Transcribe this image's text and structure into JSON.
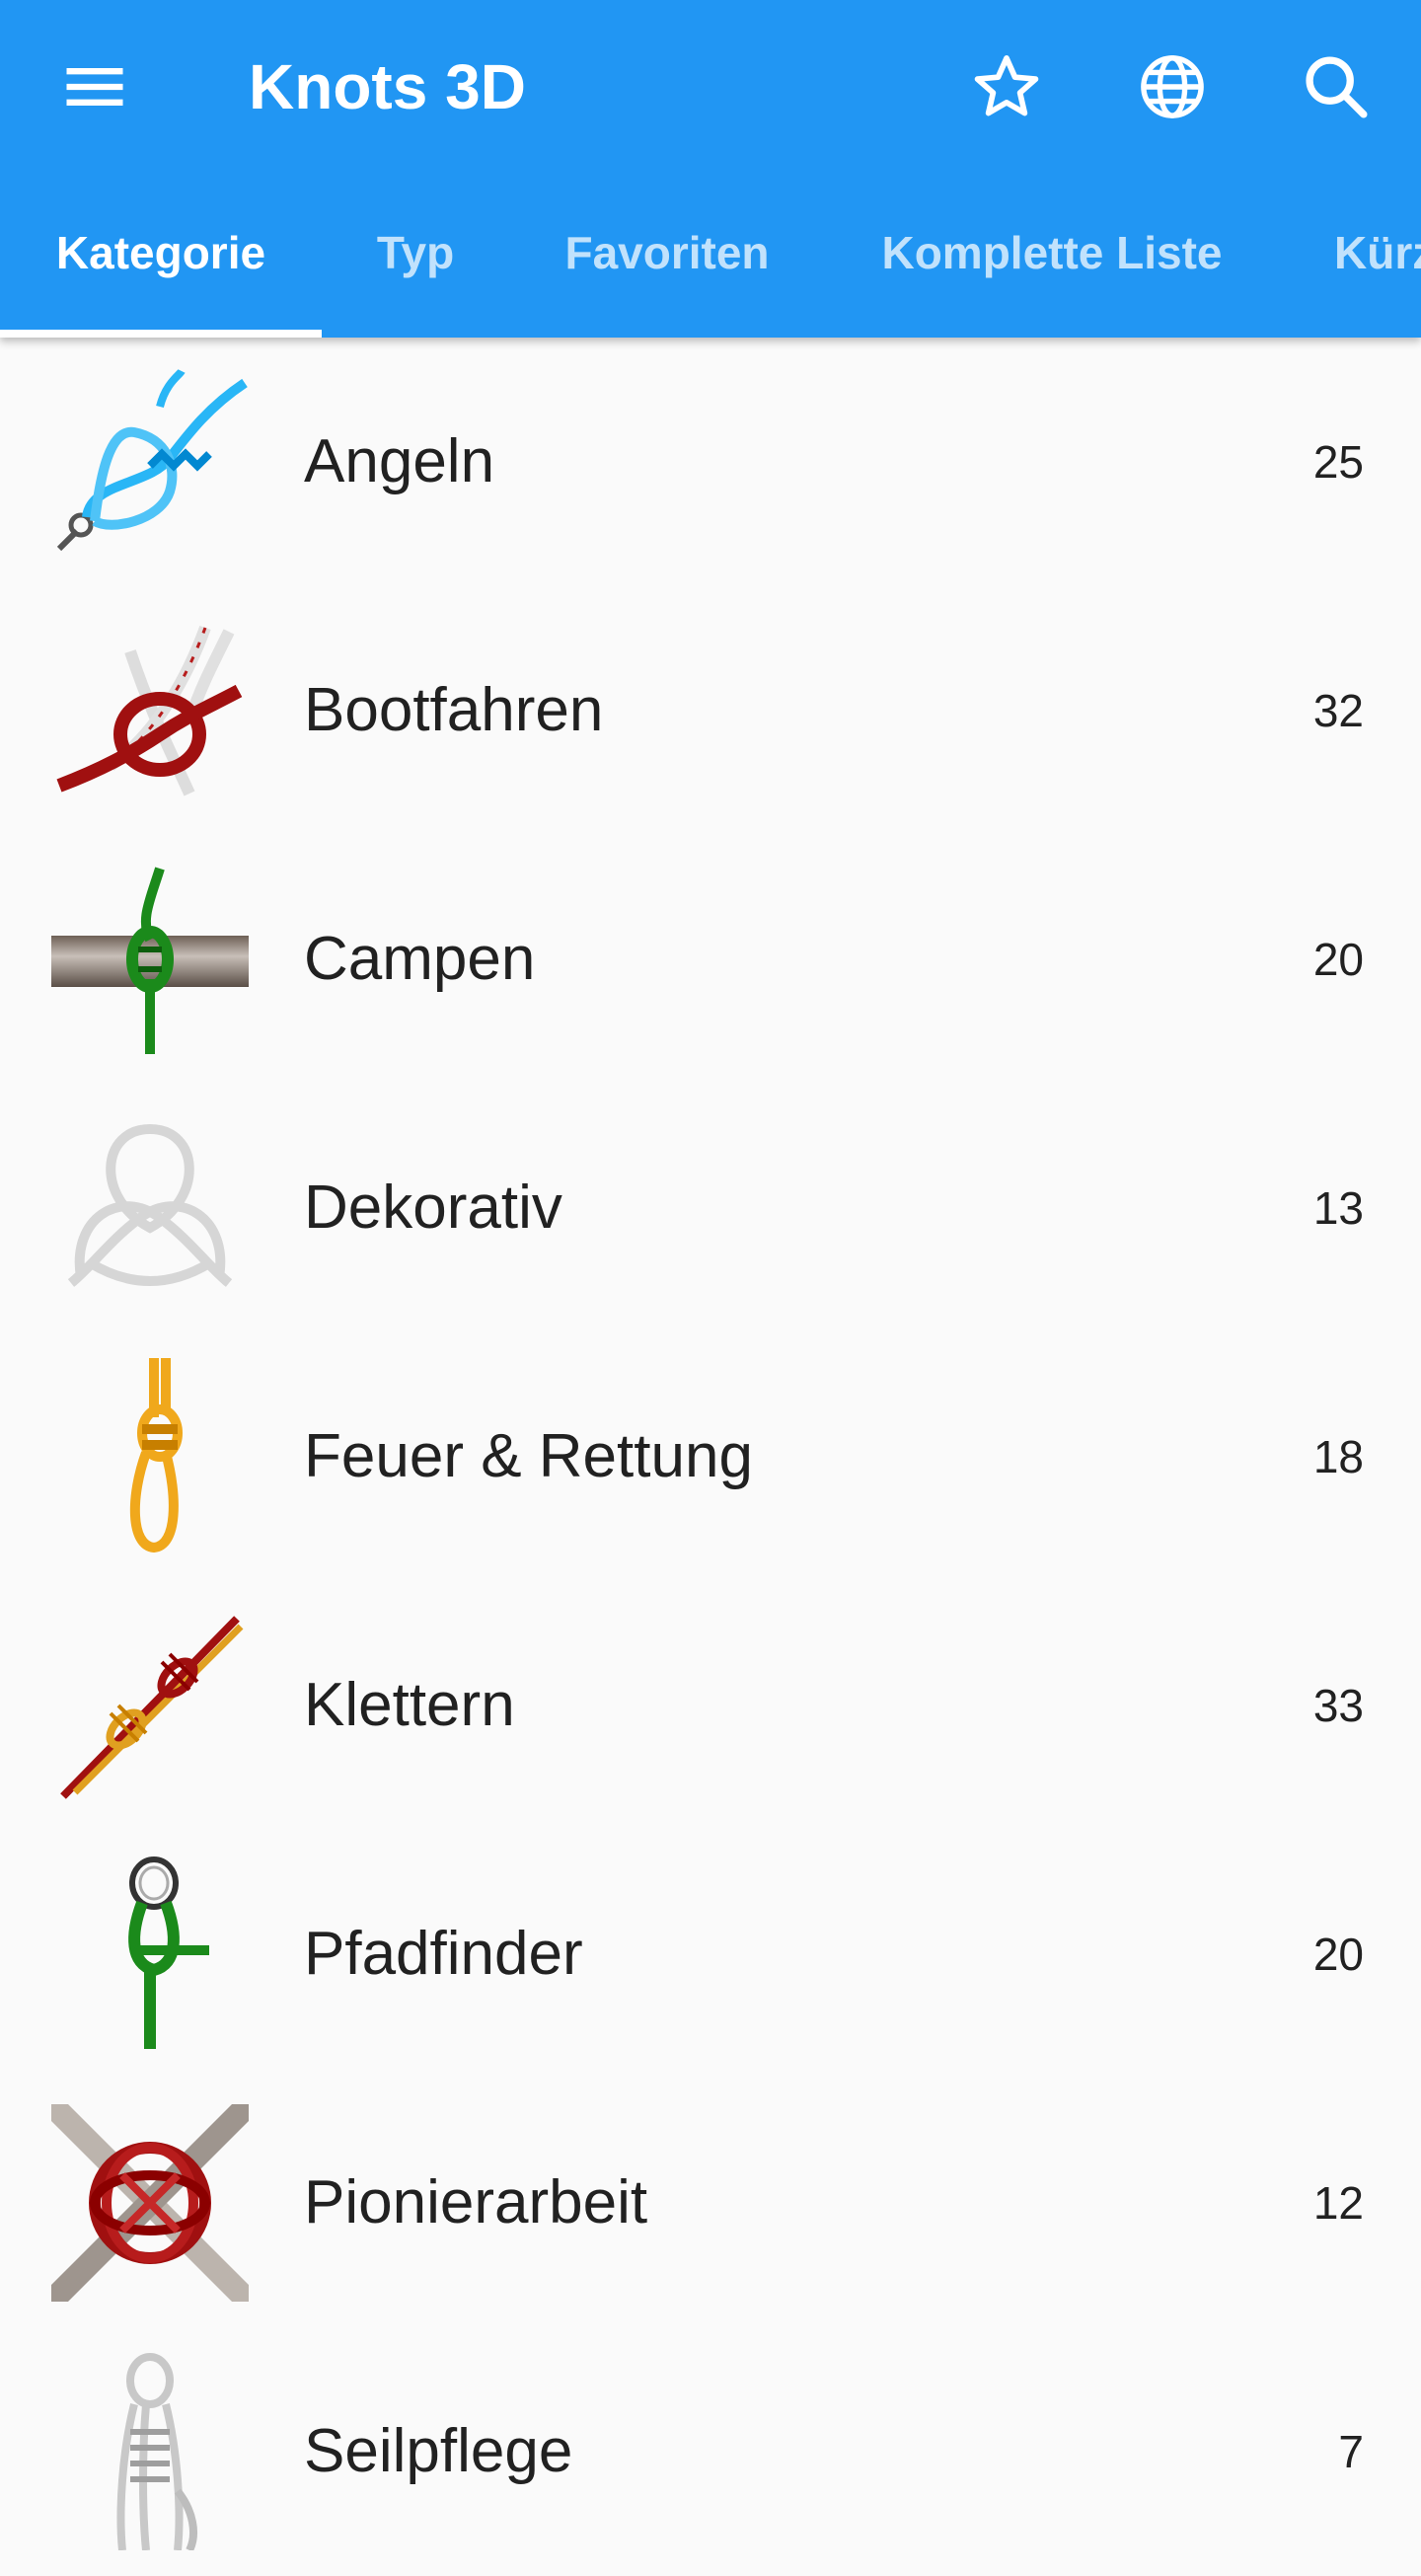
{
  "toolbar": {
    "title": "Knots 3D",
    "menu_icon": "menu-icon",
    "actions": [
      "star-icon",
      "globe-icon",
      "search-icon"
    ]
  },
  "tabs": [
    {
      "label": "Kategorie",
      "active": true
    },
    {
      "label": "Typ",
      "active": false
    },
    {
      "label": "Favoriten",
      "active": false
    },
    {
      "label": "Komplette Liste",
      "active": false
    },
    {
      "label": "Kürz",
      "active": false
    }
  ],
  "categories": [
    {
      "label": "Angeln",
      "count": "25",
      "icon": "fishing-knot-icon"
    },
    {
      "label": "Bootfahren",
      "count": "32",
      "icon": "boating-knot-icon"
    },
    {
      "label": "Campen",
      "count": "20",
      "icon": "camping-knot-icon"
    },
    {
      "label": "Dekorativ",
      "count": "13",
      "icon": "decorative-knot-icon"
    },
    {
      "label": "Feuer & Rettung",
      "count": "18",
      "icon": "rescue-knot-icon"
    },
    {
      "label": "Klettern",
      "count": "33",
      "icon": "climbing-knot-icon"
    },
    {
      "label": "Pfadfinder",
      "count": "20",
      "icon": "scouting-knot-icon"
    },
    {
      "label": "Pionierarbeit",
      "count": "12",
      "icon": "pioneering-knot-icon"
    },
    {
      "label": "Seilpflege",
      "count": "7",
      "icon": "rope-care-knot-icon"
    }
  ],
  "colors": {
    "app_bar": "#2196f3",
    "background": "#fafafa",
    "text": "#212121"
  }
}
